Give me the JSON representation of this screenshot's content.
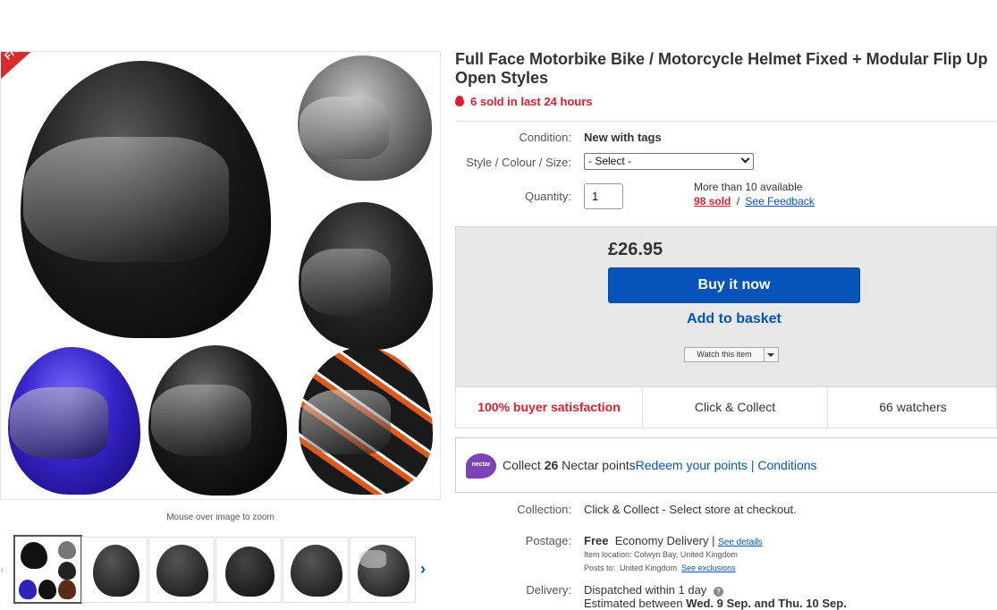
{
  "gallery": {
    "ribbon": "Free postage",
    "zoom_hint": "Mouse over image to zoom"
  },
  "listing": {
    "title": "Full Face Motorbike Bike / Motorcycle Helmet Fixed + Modular Flip Up Open Styles",
    "sold_recent": "6 sold in last 24 hours"
  },
  "details": {
    "condition_label": "Condition:",
    "condition_value": "New with tags",
    "style_label": "Style / Colour / Size:",
    "style_selected": "- Select -",
    "quantity_label": "Quantity:",
    "quantity_value": "1",
    "availability": "More than 10 available",
    "sold_count": "98 sold",
    "separator": "/",
    "see_feedback": "See Feedback"
  },
  "buybox": {
    "price": "£26.95",
    "buy_now": "Buy it now",
    "add_basket": "Add to basket",
    "watch": "Watch this item"
  },
  "stats": {
    "satisfaction": "100% buyer satisfaction",
    "click_collect": "Click & Collect",
    "watchers": "66 watchers"
  },
  "nectar": {
    "logo": "nectar",
    "collect_prefix": "Collect",
    "points": "26",
    "collect_suffix": "Nectar points",
    "redeem": "Redeem your points",
    "pipe": "|",
    "conditions": "Conditions"
  },
  "shipping": {
    "collection_label": "Collection:",
    "collection_value": "Click & Collect - Select store at checkout.",
    "postage_label": "Postage:",
    "postage_free": "Free",
    "postage_type": "Economy Delivery",
    "postage_pipe": "|",
    "see_details": "See details",
    "item_location": "Item location:  Colwyn Bay, United Kingdom",
    "posts_to_label": "Posts to:",
    "posts_to_value": "United Kingdom",
    "see_exclusions": "See exclusions",
    "delivery_label": "Delivery:",
    "delivery_value": "Dispatched within 1 day",
    "delivery_estimate_prefix": "Estimated between",
    "delivery_estimate_dates": "Wed. 9 Sep. and Thu. 10 Sep."
  },
  "colors": {
    "brand_blue": "#0654ba",
    "accent_red": "#dd1e31",
    "nectar_purple": "#7b43b6"
  }
}
